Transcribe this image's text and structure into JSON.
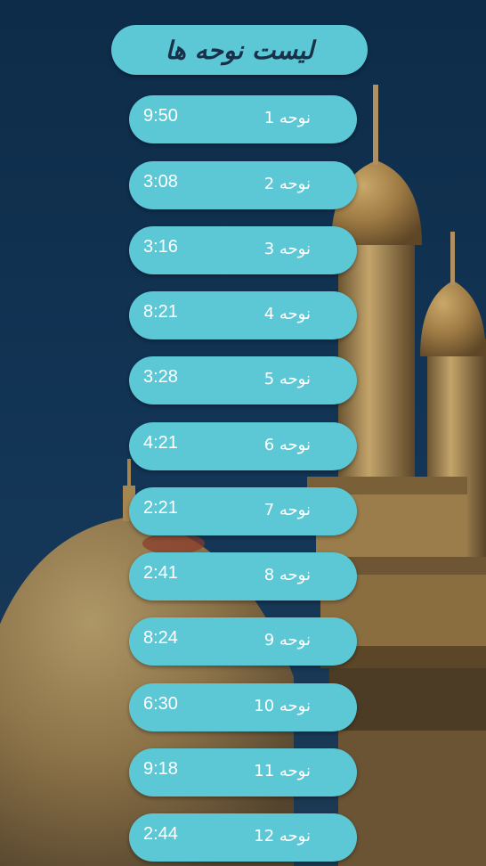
{
  "header": {
    "title": "لیست نوحه ها"
  },
  "nohe_list": [
    {
      "label": "نوحه 1",
      "duration": "9:50"
    },
    {
      "label": "نوحه 2",
      "duration": "3:08"
    },
    {
      "label": "نوحه 3",
      "duration": "3:16"
    },
    {
      "label": "نوحه 4",
      "duration": "8:21"
    },
    {
      "label": "نوحه 5",
      "duration": "3:28"
    },
    {
      "label": "نوحه 6",
      "duration": "4:21"
    },
    {
      "label": "نوحه 7",
      "duration": "2:21"
    },
    {
      "label": "نوحه 8",
      "duration": "2:41"
    },
    {
      "label": "نوحه 9",
      "duration": "8:24"
    },
    {
      "label": "نوحه 10",
      "duration": "6:30"
    },
    {
      "label": "نوحه 11",
      "duration": "9:18"
    },
    {
      "label": "نوحه 12",
      "duration": "2:44"
    }
  ],
  "colors": {
    "background": "#0f3150",
    "pill": "#5cc8d6",
    "title_text": "#1a2f48",
    "item_text": "#ffffff",
    "gold": "#b8945a"
  }
}
